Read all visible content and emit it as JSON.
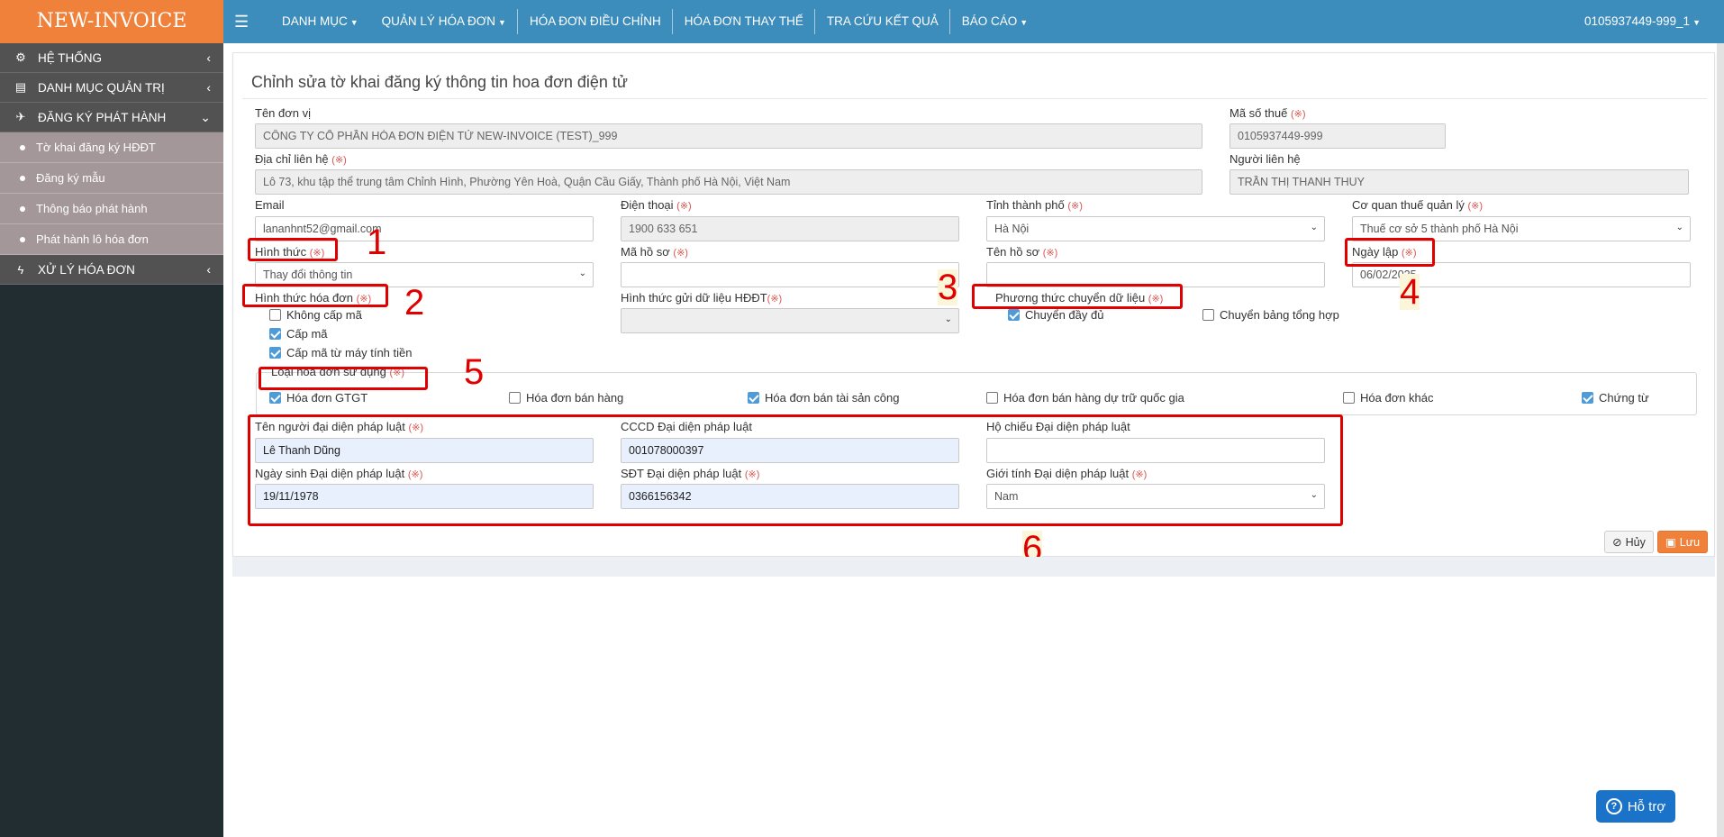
{
  "app": {
    "logo": "NEW-INVOICE",
    "account": "0105937449-999_1"
  },
  "topnav": [
    {
      "label": "DANH MỤC",
      "dropdown": true
    },
    {
      "label": "QUẢN LÝ HÓA ĐƠN",
      "dropdown": true
    },
    {
      "label": "HÓA ĐƠN ĐIỀU CHỈNH",
      "dropdown": false
    },
    {
      "label": "HÓA ĐƠN THAY THẾ",
      "dropdown": false
    },
    {
      "label": "TRA CỨU KẾT QUẢ",
      "dropdown": false
    },
    {
      "label": "BÁO CÁO",
      "dropdown": true
    }
  ],
  "sidebar": {
    "menus": [
      {
        "label": "HỆ THỐNG",
        "icon": "gears-icon",
        "arrow": "‹"
      },
      {
        "label": "DANH MỤC QUẢN TRỊ",
        "icon": "file-icon",
        "arrow": "‹"
      },
      {
        "label": "ĐĂNG KÝ PHÁT HÀNH",
        "icon": "plane-icon",
        "arrow": "⌄"
      }
    ],
    "submenus": [
      {
        "label": "Tờ khai đăng ký HĐĐT"
      },
      {
        "label": "Đăng ký mẫu"
      },
      {
        "label": "Thông báo phát hành"
      },
      {
        "label": "Phát hành lô hóa đơn"
      }
    ],
    "last_menu": {
      "label": "XỬ LÝ HÓA ĐƠN",
      "icon": "bolt-icon",
      "arrow": "‹"
    }
  },
  "page": {
    "title": "Chỉnh sửa tờ khai đăng ký thông tin hoa đơn điện tử"
  },
  "required_mark": "(※)",
  "form": {
    "ten_don_vi": {
      "label": "Tên đơn vị",
      "value": "CÔNG TY CỔ PHẦN HÓA ĐƠN ĐIỆN TỬ NEW-INVOICE (TEST)_999"
    },
    "ma_so_thue": {
      "label": "Mã số thuế",
      "value": "0105937449-999"
    },
    "dia_chi": {
      "label": "Địa chỉ liên hệ",
      "value": "Lô 73, khu tập thể trung tâm Chỉnh Hình, Phường Yên Hoà, Quận Cầu Giấy, Thành phố Hà Nội, Việt Nam"
    },
    "nguoi_lien_he": {
      "label": "Người liên hệ",
      "value": "TRẦN THỊ THANH THUY"
    },
    "email": {
      "label": "Email",
      "value": "lananhnt52@gmail.com"
    },
    "dien_thoai": {
      "label": "Điện thoại",
      "value": "1900 633 651"
    },
    "tinh_thanh_pho": {
      "label": "Tỉnh thành phố",
      "value": "Hà Nội"
    },
    "co_quan_thue": {
      "label": "Cơ quan thuế quản lý",
      "value": "Thuế cơ sở 5 thành phố Hà Nội"
    },
    "hinh_thuc": {
      "label": "Hình thức",
      "value": "Thay đổi thông tin"
    },
    "ma_ho_so": {
      "label": "Mã hồ sơ",
      "value": ""
    },
    "ten_ho_so": {
      "label": "Tên hồ sơ",
      "value": ""
    },
    "ngay_lap": {
      "label": "Ngày lập",
      "value": "06/02/2025"
    },
    "hinh_thuc_hoa_don": {
      "label": "Hình thức hóa đơn",
      "options": [
        {
          "label": "Không cấp mã",
          "checked": false
        },
        {
          "label": "Cấp mã",
          "checked": true
        },
        {
          "label": "Cấp mã từ máy tính tiền",
          "checked": true
        }
      ]
    },
    "hinh_thuc_gui": {
      "label": "Hình thức gửi dữ liệu HĐĐT",
      "value": ""
    },
    "phuong_thuc": {
      "label": "Phương thức chuyển dữ liệu",
      "options": [
        {
          "label": "Chuyển đầy đủ",
          "checked": true
        },
        {
          "label": "Chuyển bảng tổng hợp",
          "checked": false
        }
      ]
    },
    "loai_hoa_don": {
      "label": "Loại hóa đơn sử dụng",
      "options": [
        {
          "label": "Hóa đơn GTGT",
          "checked": true
        },
        {
          "label": "Hóa đơn bán hàng",
          "checked": false
        },
        {
          "label": "Hóa đơn bán tài sản công",
          "checked": true
        },
        {
          "label": "Hóa đơn bán hàng dự trữ quốc gia",
          "checked": false
        },
        {
          "label": "Hóa đơn khác",
          "checked": false
        },
        {
          "label": "Chứng từ",
          "checked": true
        }
      ]
    },
    "ten_nguoi_dai_dien": {
      "label": "Tên người đại diện pháp luật",
      "value": "Lê Thanh Dũng"
    },
    "cccd": {
      "label": "CCCD Đại diện pháp luật",
      "value": "001078000397"
    },
    "ho_chieu": {
      "label": "Hộ chiếu Đại diện pháp luật",
      "value": ""
    },
    "ngay_sinh": {
      "label": "Ngày sinh Đại diện pháp luật",
      "value": "19/11/1978"
    },
    "sdt": {
      "label": "SĐT Đại diện pháp luật",
      "value": "0366156342"
    },
    "gioi_tinh": {
      "label": "Giới tính Đại diện pháp luật",
      "value": "Nam"
    }
  },
  "buttons": {
    "cancel": "Hủy",
    "save": "Lưu"
  },
  "annotations": [
    "1",
    "2",
    "3",
    "4",
    "5",
    "6"
  ],
  "help": {
    "label": "Hỗ trợ"
  },
  "colors": {
    "topbar": "#3c8dbc",
    "logo": "#f0813a",
    "sidebar": "#222d32",
    "required": "#d9534f",
    "annotation": "#e00000"
  }
}
